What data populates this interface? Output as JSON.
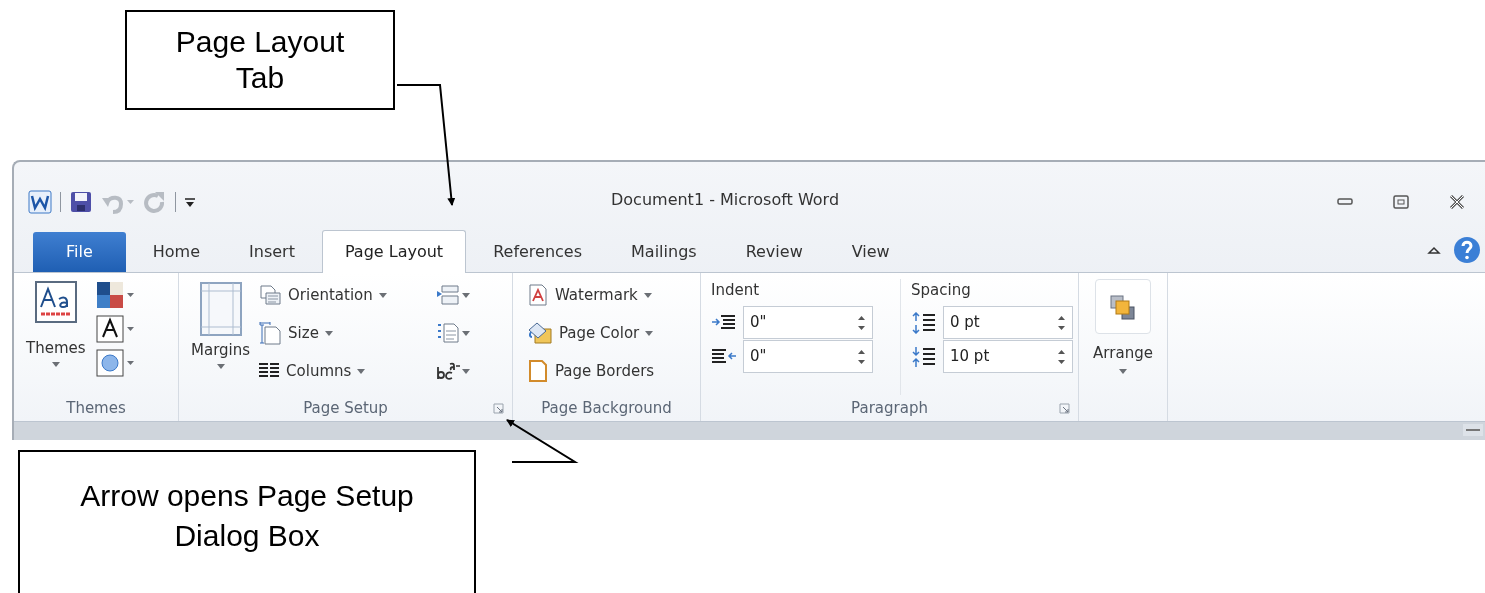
{
  "annotations": [
    {
      "text": "Page Layout Tab"
    },
    {
      "text": "Arrow opens Page Setup Dialog Box"
    }
  ],
  "window": {
    "title": "Document1 - Microsoft Word"
  },
  "tabs": [
    {
      "label": "File",
      "kind": "file",
      "selected": false
    },
    {
      "label": "Home",
      "kind": "tab",
      "selected": false
    },
    {
      "label": "Insert",
      "kind": "tab",
      "selected": false
    },
    {
      "label": "Page Layout",
      "kind": "tab",
      "selected": true
    },
    {
      "label": "References",
      "kind": "tab",
      "selected": false
    },
    {
      "label": "Mailings",
      "kind": "tab",
      "selected": false
    },
    {
      "label": "Review",
      "kind": "tab",
      "selected": false
    },
    {
      "label": "View",
      "kind": "tab",
      "selected": false
    }
  ],
  "ribbon": {
    "themes": {
      "label": "Themes",
      "button": "Themes"
    },
    "page_setup": {
      "label": "Page Setup",
      "margins": "Margins",
      "items": [
        "Orientation",
        "Size",
        "Columns"
      ]
    },
    "page_background": {
      "label": "Page Background",
      "items": [
        "Watermark",
        "Page Color",
        "Page Borders"
      ]
    },
    "paragraph": {
      "label": "Paragraph",
      "indent_label": "Indent",
      "spacing_label": "Spacing",
      "indent": [
        "0\"",
        "0\""
      ],
      "spacing": [
        "0 pt",
        "10 pt"
      ]
    },
    "arrange": {
      "label": "Arrange"
    }
  }
}
